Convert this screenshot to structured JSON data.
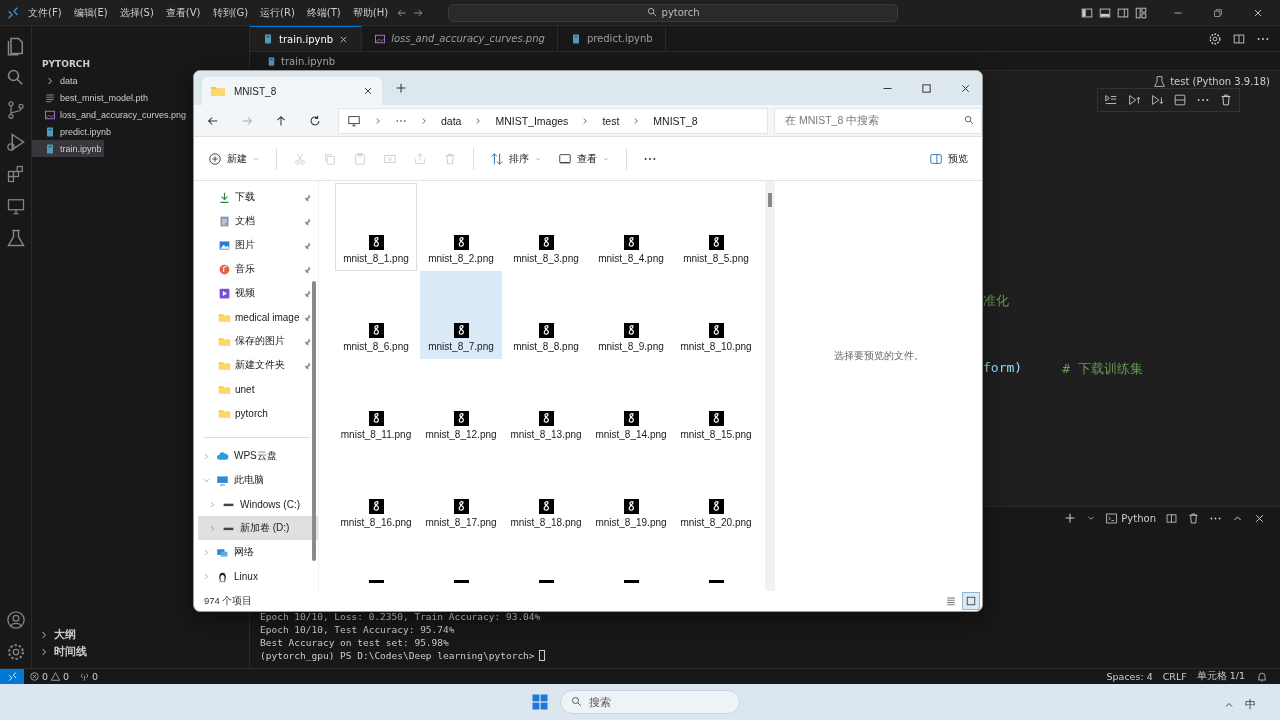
{
  "vscode": {
    "menu": [
      "文件(F)",
      "编辑(E)",
      "选择(S)",
      "查看(V)",
      "转到(G)",
      "运行(R)",
      "终端(T)",
      "帮助(H)"
    ],
    "search": {
      "value": "pytorch"
    },
    "tabs": [
      {
        "label": "train.ipynb",
        "selected": true,
        "preview": false,
        "kind": "notebook"
      },
      {
        "label": "loss_and_accuracy_curves.png",
        "selected": false,
        "preview": true,
        "kind": "image"
      },
      {
        "label": "predict.ipynb",
        "selected": false,
        "preview": false,
        "kind": "notebook"
      }
    ],
    "breadcrumb": "train.ipynb",
    "explorer": {
      "section": "PYTORCH",
      "items": [
        {
          "label": "data",
          "kind": "folder",
          "expanded": false,
          "selected": false
        },
        {
          "label": "best_mnist_model.pth",
          "kind": "file",
          "selected": false
        },
        {
          "label": "loss_and_accuracy_curves.png",
          "kind": "image",
          "selected": false
        },
        {
          "label": "predict.ipynb",
          "kind": "notebook",
          "selected": false
        },
        {
          "label": "train.ipynb",
          "kind": "notebook",
          "selected": true
        }
      ]
    },
    "bottom_sections": [
      {
        "label": "大纲",
        "expanded": false
      },
      {
        "label": "时间线",
        "expanded": false
      }
    ],
    "kernel": "test (Python 3.9.18)",
    "code_lines": [
      {
        "segments": [
          {
            "text": "准化",
            "kind": "comment"
          }
        ]
      },
      {
        "segments": [
          {
            "text": "form)",
            "kind": "code"
          },
          {
            "text": "# 下载训练集",
            "kind": "comment"
          }
        ]
      }
    ],
    "terminal": {
      "shell": "Python",
      "lines": [
        "Epoch 10/10, Loss: 0.2350, Train Accuracy: 93.04%",
        "Epoch 10/10, Test Accuracy: 95.74%",
        "Best Accuracy on test set: 95.98%"
      ],
      "prompt": "(pytorch_gpu) PS D:\\Codes\\Deep learning\\pytorch>"
    },
    "status_bar": {
      "errors": "0",
      "warnings": "0",
      "ports": "0",
      "right": [
        "Spaces: 4",
        "CRLF",
        "单元格 1/1"
      ]
    }
  },
  "file_window": {
    "tab": "MNIST_8",
    "path": [
      "data",
      "MNIST_Images",
      "test",
      "MNIST_8"
    ],
    "search": {
      "placeholder": "在 MNIST_8 中搜索"
    },
    "toolbar": {
      "new": "新建",
      "sort": "排序",
      "view": "查看",
      "preview": "预览"
    },
    "nav": [
      {
        "label": "下载",
        "kind": "download",
        "pinned": true
      },
      {
        "label": "文档",
        "kind": "document",
        "pinned": true
      },
      {
        "label": "图片",
        "kind": "picture",
        "pinned": true
      },
      {
        "label": "音乐",
        "kind": "music",
        "pinned": true
      },
      {
        "label": "视频",
        "kind": "video",
        "pinned": true
      },
      {
        "label": "medical image",
        "kind": "folder",
        "pinned": true
      },
      {
        "label": "保存的图片",
        "kind": "folder",
        "pinned": true
      },
      {
        "label": "新建文件夹",
        "kind": "folder",
        "pinned": true
      },
      {
        "label": "unet",
        "kind": "folder",
        "pinned": false
      },
      {
        "label": "pytorch",
        "kind": "folder",
        "pinned": false
      }
    ],
    "tree": [
      {
        "label": "WPS云盘",
        "kind": "cloud",
        "expanded": false,
        "selected": false
      },
      {
        "label": "此电脑",
        "kind": "pc",
        "expanded": true,
        "selected": false,
        "children": [
          {
            "label": "Windows (C:)",
            "kind": "drive",
            "expanded": false,
            "selected": false
          },
          {
            "label": "新加卷 (D:)",
            "kind": "drive",
            "expanded": false,
            "selected": true
          }
        ]
      },
      {
        "label": "网络",
        "kind": "network",
        "expanded": false,
        "selected": false
      },
      {
        "label": "Linux",
        "kind": "linux",
        "expanded": false,
        "selected": false
      }
    ],
    "files": [
      {
        "kind": "file",
        "name": "mnist_8_1.png",
        "selected": false,
        "focused": true
      },
      {
        "kind": "file",
        "name": "mnist_8_2.png",
        "selected": false,
        "focused": false
      },
      {
        "kind": "file",
        "name": "mnist_8_3.png",
        "selected": false,
        "focused": false
      },
      {
        "kind": "file",
        "name": "mnist_8_4.png",
        "selected": false,
        "focused": false
      },
      {
        "kind": "file",
        "name": "mnist_8_5.png",
        "selected": false,
        "focused": false
      },
      {
        "kind": "file",
        "name": "mnist_8_6.png",
        "selected": false,
        "focused": false
      },
      {
        "kind": "file",
        "name": "mnist_8_7.png",
        "selected": true,
        "focused": false
      },
      {
        "kind": "file",
        "name": "mnist_8_8.png",
        "selected": false,
        "focused": false
      },
      {
        "kind": "file",
        "name": "mnist_8_9.png",
        "selected": false,
        "focused": false
      },
      {
        "kind": "file",
        "name": "mnist_8_10.png",
        "selected": false,
        "focused": false
      },
      {
        "kind": "file",
        "name": "mnist_8_11.png",
        "selected": false,
        "focused": false
      },
      {
        "kind": "file",
        "name": "mnist_8_12.png",
        "selected": false,
        "focused": false
      },
      {
        "kind": "file",
        "name": "mnist_8_13.png",
        "selected": false,
        "focused": false
      },
      {
        "kind": "file",
        "name": "mnist_8_14.png",
        "selected": false,
        "focused": false
      },
      {
        "kind": "file",
        "name": "mnist_8_15.png",
        "selected": false,
        "focused": false
      },
      {
        "kind": "file",
        "name": "mnist_8_16.png",
        "selected": false,
        "focused": false
      },
      {
        "kind": "file",
        "name": "mnist_8_17.png",
        "selected": false,
        "focused": false
      },
      {
        "kind": "file",
        "name": "mnist_8_18.png",
        "selected": false,
        "focused": false
      },
      {
        "kind": "file",
        "name": "mnist_8_19.png",
        "selected": false,
        "focused": false
      },
      {
        "kind": "file",
        "name": "mnist_8_20.png",
        "selected": false,
        "focused": false
      },
      {
        "kind": "cut",
        "selected": false,
        "focused": false
      },
      {
        "kind": "cut",
        "selected": false,
        "focused": false
      },
      {
        "kind": "cut",
        "selected": false,
        "focused": false
      },
      {
        "kind": "cut",
        "selected": false,
        "focused": false
      },
      {
        "kind": "cut",
        "selected": false,
        "focused": false
      }
    ],
    "preview_hint": "选择要预览的文件。",
    "count": "974 个项目",
    "views": [
      {
        "kind": "details",
        "selected": false
      },
      {
        "kind": "tiles",
        "selected": true
      }
    ]
  },
  "taskbar": {
    "search": {
      "placeholder": "搜索"
    },
    "ime": "中"
  }
}
